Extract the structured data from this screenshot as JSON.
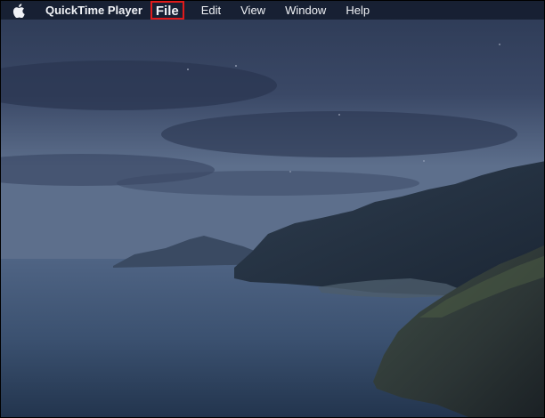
{
  "menubar": {
    "apple_icon": "apple-logo",
    "app_name": "QuickTime Player",
    "items": [
      {
        "label": "File",
        "highlighted": true
      },
      {
        "label": "Edit"
      },
      {
        "label": "View"
      },
      {
        "label": "Window"
      },
      {
        "label": "Help"
      }
    ]
  },
  "desktop": {
    "wallpaper": "macOS Catalina night coastline",
    "highlight_color": "#e01b1b"
  }
}
